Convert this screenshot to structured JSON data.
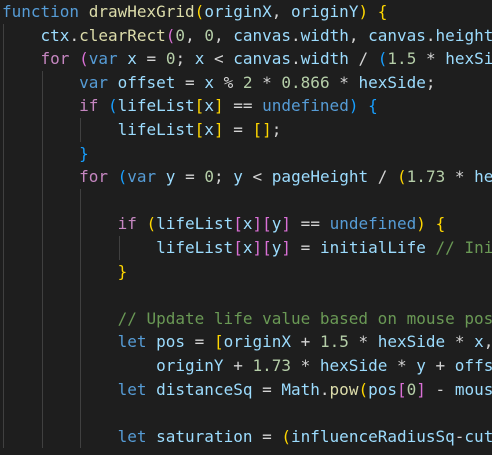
{
  "editor": {
    "language": "javascript",
    "theme": "dark",
    "colors": {
      "background": "#1e1e1e",
      "keyword": "#569cd6",
      "control": "#c586c0",
      "function": "#dcdcaa",
      "variable": "#9cdcfe",
      "number": "#b5cea8",
      "comment": "#6a9955",
      "bracket1": "#ffd700",
      "bracket2": "#da70d6",
      "bracket3": "#179fff"
    },
    "lines": [
      {
        "tokens": [
          {
            "t": "function",
            "c": "kw"
          },
          {
            "t": " "
          },
          {
            "t": "drawHexGrid",
            "c": "fn"
          },
          {
            "t": "(",
            "c": "b1"
          },
          {
            "t": "originX",
            "c": "var"
          },
          {
            "t": ", "
          },
          {
            "t": "originY",
            "c": "var"
          },
          {
            "t": ")",
            "c": "b1"
          },
          {
            "t": " "
          },
          {
            "t": "{",
            "c": "b1"
          }
        ]
      },
      {
        "tokens": [
          {
            "t": "    "
          },
          {
            "t": "ctx",
            "c": "var"
          },
          {
            "t": "."
          },
          {
            "t": "clearRect",
            "c": "fn"
          },
          {
            "t": "(",
            "c": "b2"
          },
          {
            "t": "0",
            "c": "num"
          },
          {
            "t": ", "
          },
          {
            "t": "0",
            "c": "num"
          },
          {
            "t": ", "
          },
          {
            "t": "canvas",
            "c": "var"
          },
          {
            "t": "."
          },
          {
            "t": "width",
            "c": "var"
          },
          {
            "t": ", "
          },
          {
            "t": "canvas",
            "c": "var"
          },
          {
            "t": "."
          },
          {
            "t": "height",
            "c": "var"
          }
        ]
      },
      {
        "tokens": [
          {
            "t": "    "
          },
          {
            "t": "for",
            "c": "ctl"
          },
          {
            "t": " "
          },
          {
            "t": "(",
            "c": "b2"
          },
          {
            "t": "var",
            "c": "kw"
          },
          {
            "t": " "
          },
          {
            "t": "x",
            "c": "var"
          },
          {
            "t": " = "
          },
          {
            "t": "0",
            "c": "num"
          },
          {
            "t": "; "
          },
          {
            "t": "x",
            "c": "var"
          },
          {
            "t": " < "
          },
          {
            "t": "canvas",
            "c": "var"
          },
          {
            "t": "."
          },
          {
            "t": "width",
            "c": "var"
          },
          {
            "t": " / "
          },
          {
            "t": "(",
            "c": "b3"
          },
          {
            "t": "1.5",
            "c": "num"
          },
          {
            "t": " * "
          },
          {
            "t": "hexSide",
            "c": "var"
          }
        ]
      },
      {
        "tokens": [
          {
            "t": "        "
          },
          {
            "t": "var",
            "c": "kw"
          },
          {
            "t": " "
          },
          {
            "t": "offset",
            "c": "var"
          },
          {
            "t": " = "
          },
          {
            "t": "x",
            "c": "var"
          },
          {
            "t": " % "
          },
          {
            "t": "2",
            "c": "num"
          },
          {
            "t": " * "
          },
          {
            "t": "0.866",
            "c": "num"
          },
          {
            "t": " * "
          },
          {
            "t": "hexSide",
            "c": "var"
          },
          {
            "t": ";"
          }
        ]
      },
      {
        "tokens": [
          {
            "t": "        "
          },
          {
            "t": "if",
            "c": "ctl"
          },
          {
            "t": " "
          },
          {
            "t": "(",
            "c": "b3"
          },
          {
            "t": "lifeList",
            "c": "var"
          },
          {
            "t": "[",
            "c": "b1"
          },
          {
            "t": "x",
            "c": "var"
          },
          {
            "t": "]",
            "c": "b1"
          },
          {
            "t": " == "
          },
          {
            "t": "undefined",
            "c": "kw"
          },
          {
            "t": ")",
            "c": "b3"
          },
          {
            "t": " "
          },
          {
            "t": "{",
            "c": "b3"
          }
        ]
      },
      {
        "tokens": [
          {
            "t": "            "
          },
          {
            "t": "lifeList",
            "c": "var"
          },
          {
            "t": "[",
            "c": "b1"
          },
          {
            "t": "x",
            "c": "var"
          },
          {
            "t": "]",
            "c": "b1"
          },
          {
            "t": " = "
          },
          {
            "t": "[]",
            "c": "b1"
          },
          {
            "t": ";"
          }
        ]
      },
      {
        "tokens": [
          {
            "t": "        "
          },
          {
            "t": "}",
            "c": "b3"
          }
        ]
      },
      {
        "tokens": [
          {
            "t": "        "
          },
          {
            "t": "for",
            "c": "ctl"
          },
          {
            "t": " "
          },
          {
            "t": "(",
            "c": "b3"
          },
          {
            "t": "var",
            "c": "kw"
          },
          {
            "t": " "
          },
          {
            "t": "y",
            "c": "var"
          },
          {
            "t": " = "
          },
          {
            "t": "0",
            "c": "num"
          },
          {
            "t": "; "
          },
          {
            "t": "y",
            "c": "var"
          },
          {
            "t": " < "
          },
          {
            "t": "pageHeight",
            "c": "var"
          },
          {
            "t": " / "
          },
          {
            "t": "(",
            "c": "b1"
          },
          {
            "t": "1.73",
            "c": "num"
          },
          {
            "t": " * "
          },
          {
            "t": "he",
            "c": "var"
          }
        ]
      },
      {
        "tokens": []
      },
      {
        "tokens": [
          {
            "t": "            "
          },
          {
            "t": "if",
            "c": "ctl"
          },
          {
            "t": " "
          },
          {
            "t": "(",
            "c": "b1"
          },
          {
            "t": "lifeList",
            "c": "var"
          },
          {
            "t": "[",
            "c": "b2"
          },
          {
            "t": "x",
            "c": "var"
          },
          {
            "t": "]",
            "c": "b2"
          },
          {
            "t": "[",
            "c": "b2"
          },
          {
            "t": "y",
            "c": "var"
          },
          {
            "t": "]",
            "c": "b2"
          },
          {
            "t": " == "
          },
          {
            "t": "undefined",
            "c": "kw"
          },
          {
            "t": ")",
            "c": "b1"
          },
          {
            "t": " "
          },
          {
            "t": "{",
            "c": "b1"
          }
        ]
      },
      {
        "tokens": [
          {
            "t": "                "
          },
          {
            "t": "lifeList",
            "c": "var"
          },
          {
            "t": "[",
            "c": "b2"
          },
          {
            "t": "x",
            "c": "var"
          },
          {
            "t": "]",
            "c": "b2"
          },
          {
            "t": "[",
            "c": "b2"
          },
          {
            "t": "y",
            "c": "var"
          },
          {
            "t": "]",
            "c": "b2"
          },
          {
            "t": " = "
          },
          {
            "t": "initialLife",
            "c": "var"
          },
          {
            "t": " "
          },
          {
            "t": "// Ini",
            "c": "cmt"
          }
        ]
      },
      {
        "tokens": [
          {
            "t": "            "
          },
          {
            "t": "}",
            "c": "b1"
          }
        ]
      },
      {
        "tokens": []
      },
      {
        "tokens": [
          {
            "t": "            "
          },
          {
            "t": "// Update life value based on mouse pos",
            "c": "cmt"
          }
        ]
      },
      {
        "tokens": [
          {
            "t": "            "
          },
          {
            "t": "let",
            "c": "kw"
          },
          {
            "t": " "
          },
          {
            "t": "pos",
            "c": "var"
          },
          {
            "t": " = "
          },
          {
            "t": "[",
            "c": "b1"
          },
          {
            "t": "originX",
            "c": "var"
          },
          {
            "t": " + "
          },
          {
            "t": "1.5",
            "c": "num"
          },
          {
            "t": " * "
          },
          {
            "t": "hexSide",
            "c": "var"
          },
          {
            "t": " * "
          },
          {
            "t": "x",
            "c": "var"
          },
          {
            "t": ","
          }
        ]
      },
      {
        "tokens": [
          {
            "t": "                "
          },
          {
            "t": "originY",
            "c": "var"
          },
          {
            "t": " + "
          },
          {
            "t": "1.73",
            "c": "num"
          },
          {
            "t": " * "
          },
          {
            "t": "hexSide",
            "c": "var"
          },
          {
            "t": " * "
          },
          {
            "t": "y",
            "c": "var"
          },
          {
            "t": " + "
          },
          {
            "t": "offs",
            "c": "var"
          }
        ]
      },
      {
        "tokens": [
          {
            "t": "            "
          },
          {
            "t": "let",
            "c": "kw"
          },
          {
            "t": " "
          },
          {
            "t": "distanceSq",
            "c": "var"
          },
          {
            "t": " = "
          },
          {
            "t": "Math",
            "c": "var"
          },
          {
            "t": "."
          },
          {
            "t": "pow",
            "c": "fn"
          },
          {
            "t": "(",
            "c": "b1"
          },
          {
            "t": "pos",
            "c": "var"
          },
          {
            "t": "[",
            "c": "b2"
          },
          {
            "t": "0",
            "c": "num"
          },
          {
            "t": "]",
            "c": "b2"
          },
          {
            "t": " - "
          },
          {
            "t": "mous",
            "c": "var"
          }
        ]
      },
      {
        "tokens": []
      },
      {
        "tokens": [
          {
            "t": "            "
          },
          {
            "t": "let",
            "c": "kw"
          },
          {
            "t": " "
          },
          {
            "t": "saturation",
            "c": "var"
          },
          {
            "t": " = "
          },
          {
            "t": "(",
            "c": "b1"
          },
          {
            "t": "influenceRadiusSq",
            "c": "var"
          },
          {
            "t": "-"
          },
          {
            "t": "cut",
            "c": "var"
          }
        ]
      }
    ]
  }
}
